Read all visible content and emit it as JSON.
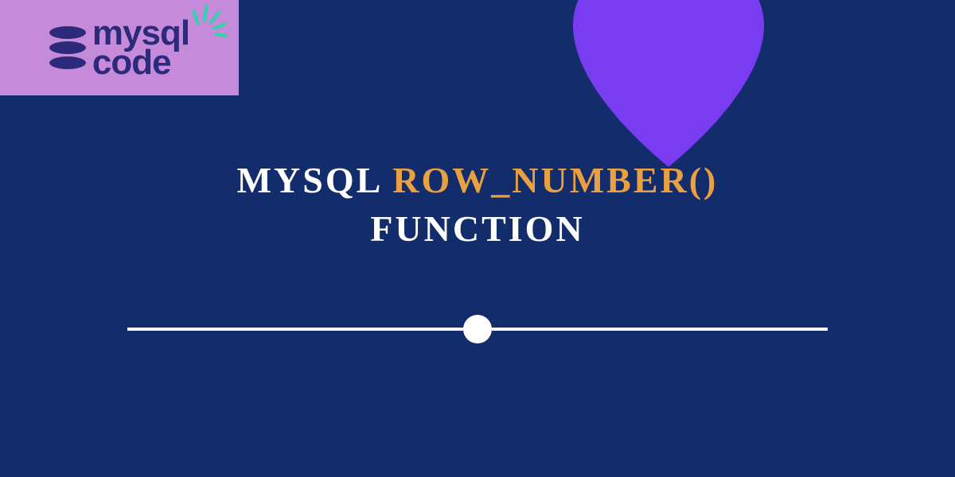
{
  "logo": {
    "line1": "mysql",
    "line2": "code"
  },
  "title": {
    "word1": "MYSQL",
    "word2": "ROW_NUMBER()",
    "word3": "FUNCTION"
  },
  "colors": {
    "background": "#132c6c",
    "accent": "#e9a040",
    "heart": "#7a3cf0",
    "logo_bg": "#c68adb",
    "logo_fg": "#2c2a7a",
    "burst": "#2dd6a6",
    "white": "#ffffff"
  }
}
